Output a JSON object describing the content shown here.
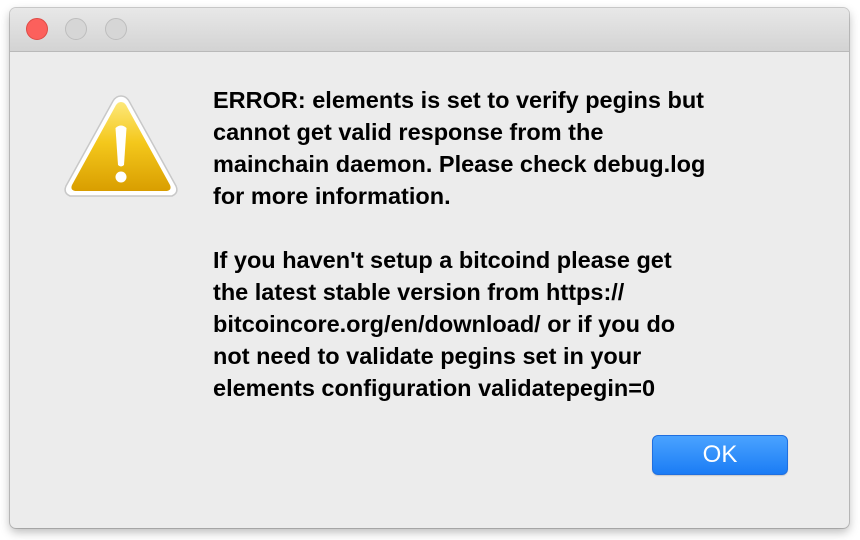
{
  "dialog": {
    "message_primary": "ERROR: elements is set to verify pegins but\ncannot get valid response from the\nmainchain daemon. Please check debug.log\nfor more information.",
    "message_secondary": "If you haven't setup a bitcoind please get\nthe latest stable version from https://\nbitcoincore.org/en/download/ or if you do\nnot need to validate pegins set in your\nelements configuration validatepegin=0",
    "ok_label": "OK",
    "icon": "warning-triangle-icon"
  },
  "colors": {
    "close_button": "#fc605c",
    "inactive_traffic_light": "#d6d6d6",
    "ok_button": "#1b7cf5",
    "warning_yellow": "#f2c200",
    "background": "#ececec"
  }
}
